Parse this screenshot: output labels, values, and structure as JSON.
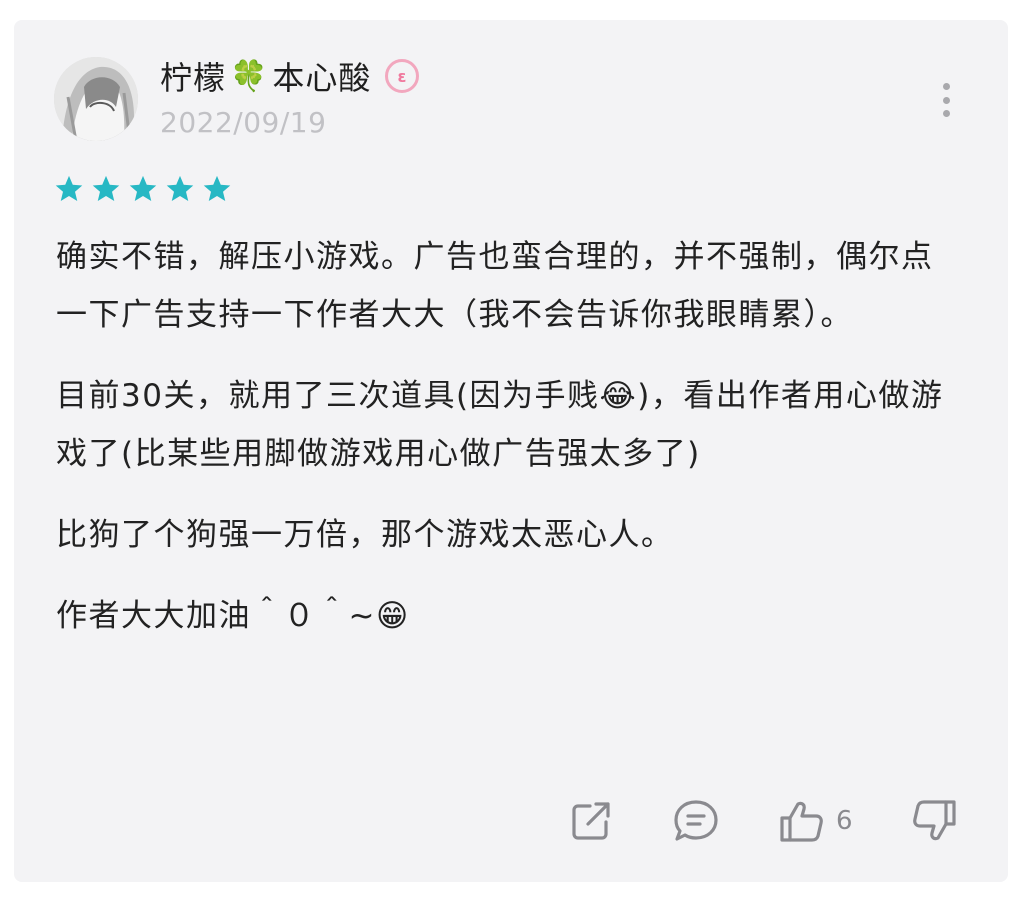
{
  "comment": {
    "author": {
      "name_part1": "柠檬",
      "name_emoji": "🍀",
      "name_part2": "本心酸",
      "badge": "ε"
    },
    "date": "2022/09/19",
    "rating": 5,
    "paragraphs": [
      "确实不错，解压小游戏。广告也蛮合理的，并不强制，偶尔点一下广告支持一下作者大大（我不会告诉你我眼睛累）。",
      "目前30关，就用了三次道具(因为手贱😂)，看出作者用心做游戏了(比某些用脚做游戏用心做广告强太多了)",
      "比狗了个狗强一万倍，那个游戏太恶心人。",
      "作者大大加油＾０＾~😁"
    ],
    "likes": "6"
  },
  "icons": [
    "share-icon",
    "reply-icon",
    "thumbs-up-icon",
    "thumbs-down-icon",
    "more-vertical-icon",
    "star-icon"
  ],
  "colors": {
    "star": "#27b8c4",
    "icon": "#8a8a8f",
    "text": "#222222",
    "date": "#c1c1c5",
    "background": "#f3f3f5",
    "badge": "#f0799e"
  }
}
